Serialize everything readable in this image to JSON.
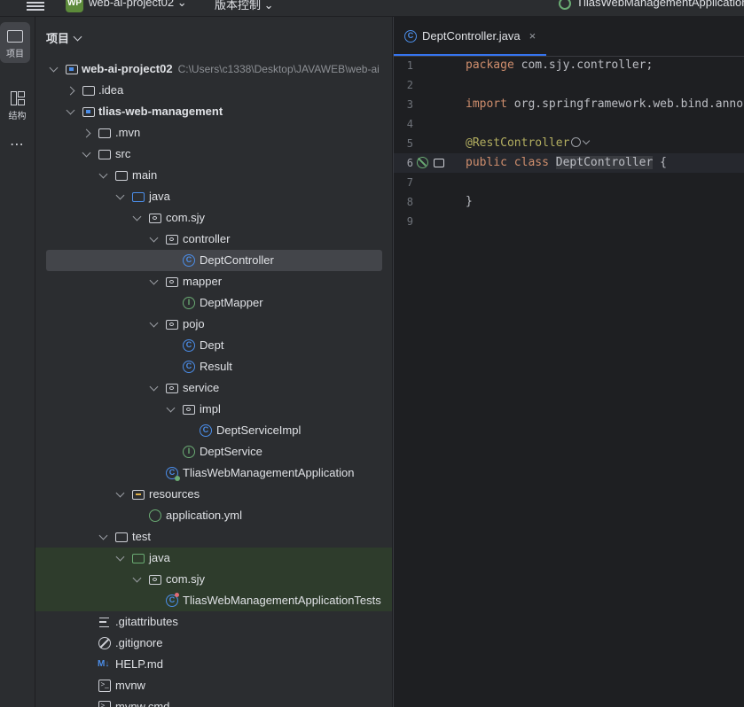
{
  "topbar": {
    "project_badge": "WP",
    "project_name": "web-ai-project02",
    "vcs_label": "版本控制",
    "run_config": "TliasWebManagementApplication"
  },
  "toolstrip": {
    "project_label": "项目",
    "structure_label": "结构",
    "more_label": "⋯"
  },
  "project_panel": {
    "title": "项目",
    "tree": [
      {
        "label": "web-ai-project02",
        "path": "C:\\Users\\c1338\\Desktop\\JAVAWEB\\web-ai",
        "icon": "module-folder-icon",
        "expanded": true
      },
      {
        "label": ".idea",
        "icon": "folder-icon",
        "expanded": false
      },
      {
        "label": "tlias-web-management",
        "icon": "module-folder-icon",
        "expanded": true
      },
      {
        "label": ".mvn",
        "icon": "folder-icon",
        "expanded": false
      },
      {
        "label": "src",
        "icon": "folder-icon",
        "expanded": true
      },
      {
        "label": "main",
        "icon": "folder-icon",
        "expanded": true
      },
      {
        "label": "java",
        "icon": "source-folder-icon",
        "expanded": true
      },
      {
        "label": "com.sjy",
        "icon": "package-icon",
        "expanded": true
      },
      {
        "label": "controller",
        "icon": "package-icon",
        "expanded": true
      },
      {
        "label": "DeptController",
        "icon": "class-icon",
        "selected": true
      },
      {
        "label": "mapper",
        "icon": "package-icon",
        "expanded": true
      },
      {
        "label": "DeptMapper",
        "icon": "interface-icon"
      },
      {
        "label": "pojo",
        "icon": "package-icon",
        "expanded": true
      },
      {
        "label": "Dept",
        "icon": "class-icon"
      },
      {
        "label": "Result",
        "icon": "class-icon"
      },
      {
        "label": "service",
        "icon": "package-icon",
        "expanded": true
      },
      {
        "label": "impl",
        "icon": "package-icon",
        "expanded": true
      },
      {
        "label": "DeptServiceImpl",
        "icon": "class-icon"
      },
      {
        "label": "DeptService",
        "icon": "interface-icon"
      },
      {
        "label": "TliasWebManagementApplication",
        "icon": "spring-app-class-icon"
      },
      {
        "label": "resources",
        "icon": "resources-folder-icon",
        "expanded": true
      },
      {
        "label": "application.yml",
        "icon": "yaml-file-icon"
      },
      {
        "label": "test",
        "icon": "folder-icon",
        "expanded": true
      },
      {
        "label": "java",
        "icon": "test-source-folder-icon",
        "expanded": true
      },
      {
        "label": "com.sjy",
        "icon": "package-icon",
        "expanded": true
      },
      {
        "label": "TliasWebManagementApplicationTests",
        "icon": "test-class-icon"
      },
      {
        "label": ".gitattributes",
        "icon": "text-file-icon"
      },
      {
        "label": ".gitignore",
        "icon": "ignore-file-icon"
      },
      {
        "label": "HELP.md",
        "icon": "markdown-file-icon"
      },
      {
        "label": "mvnw",
        "icon": "shell-file-icon"
      },
      {
        "label": "mvnw.cmd",
        "icon": "shell-file-icon"
      }
    ]
  },
  "editor": {
    "tab_label": "DeptController.java",
    "tab_close": "×",
    "lines": [
      {
        "num": "1",
        "text": "package com.sjy.controller;"
      },
      {
        "num": "2",
        "text": ""
      },
      {
        "num": "3",
        "text": "import org.springframework.web.bind.annotation.RestController;"
      },
      {
        "num": "4",
        "text": ""
      },
      {
        "num": "5",
        "text": "@RestController"
      },
      {
        "num": "6",
        "text": "public class DeptController {"
      },
      {
        "num": "7",
        "text": ""
      },
      {
        "num": "8",
        "text": "}"
      },
      {
        "num": "9",
        "text": ""
      }
    ],
    "tokens": {
      "kw_package": "package",
      "pkg_name": "com.sjy.controller;",
      "kw_import": "import",
      "import_name": "org.springframework.web.bind.annotation.RestController;",
      "annotation": "@RestController",
      "kw_public": "public",
      "kw_class": "class",
      "class_name": "DeptController",
      "open_brace": "{",
      "close_brace": "}"
    }
  },
  "colors": {
    "background": "#1e1f22",
    "panel": "#2b2d30",
    "selection": "#43454a",
    "keyword": "#cf8e6d",
    "annotation": "#b3ae60",
    "class_icon": "#4b8de8",
    "interface_icon": "#6aab73",
    "test_row_bg": "#2e3c2c"
  }
}
